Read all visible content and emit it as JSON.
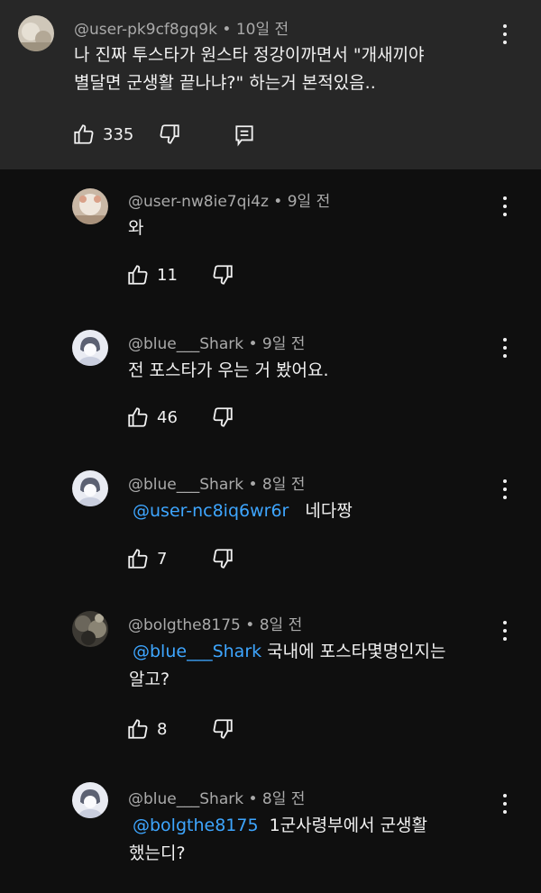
{
  "parent": {
    "author": "@user-pk9cf8gq9k",
    "time": "10일 전",
    "line1": "나 진짜 투스타가 원스타 정강이까면서 \"개새끼야",
    "line2": "별달면 군생활 끝나냐?\" 하는거 본적있음..",
    "likes": "335"
  },
  "replies": [
    {
      "author": "@user-nw8ie7qi4z",
      "time": "9일 전",
      "text": "와",
      "likes": "11"
    },
    {
      "author": "@blue___Shark",
      "time": "9일 전",
      "text": "전 포스타가 우는 거 봤어요.",
      "likes": "46"
    },
    {
      "author": "@blue___Shark",
      "time": "8일 전",
      "mention": "@user-nc8iq6wr6r",
      "text": "네다짱",
      "likes": "7"
    },
    {
      "author": "@bolgthe8175",
      "time": "8일 전",
      "mention": "@blue___Shark",
      "text": " 국내에 포스타몇명인지는",
      "text2": "알고?",
      "likes": "8"
    },
    {
      "author": "@blue___Shark",
      "time": "8일 전",
      "mention": "@bolgthe8175",
      "text": "1군사령부에서 군생활",
      "text2": "했는디?"
    }
  ],
  "separator": " • ",
  "colors": {
    "background": "#0f0f0f",
    "highlight": "#272727",
    "mention": "#3ea6ff",
    "meta": "#aaaaaa"
  }
}
